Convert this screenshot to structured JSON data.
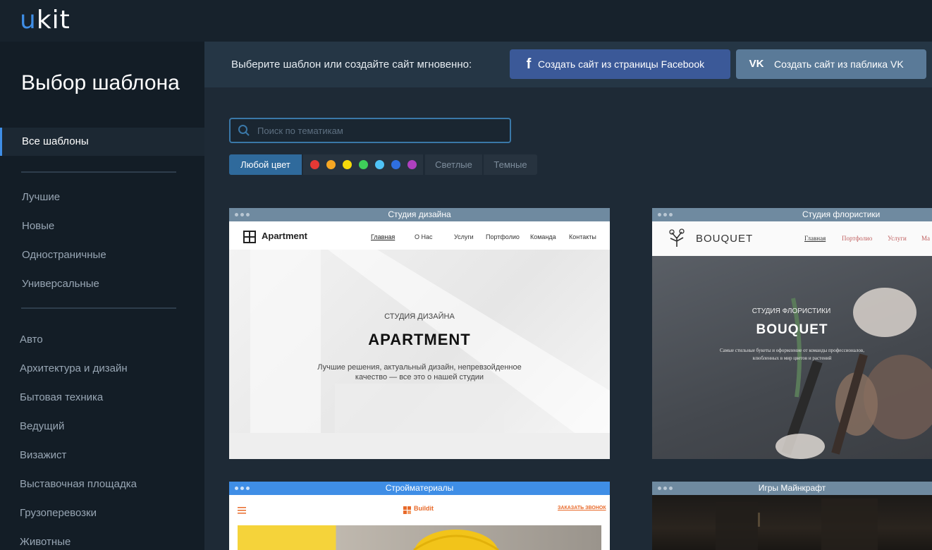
{
  "app": {
    "logo_u": "u",
    "logo_rest": "kit"
  },
  "sidebar": {
    "title": "Выбор шаблона",
    "active": "Все шаблоны",
    "groups": [
      "Лучшие",
      "Новые",
      "Одностраничные",
      "Универсальные"
    ],
    "categories": [
      "Авто",
      "Архитектура и дизайн",
      "Бытовая техника",
      "Ведущий",
      "Визажист",
      "Выставочная площадка",
      "Грузоперевозки",
      "Животные"
    ]
  },
  "promo": {
    "text": "Выберите шаблон или создайте сайт мгновенно:",
    "facebook_btn": "Создать сайт из страницы Facebook",
    "facebook_icon": "f",
    "vk_btn": "Создать сайт из паблика VK",
    "vk_icon": "VK"
  },
  "search": {
    "placeholder": "Поиск по тематикам"
  },
  "filters": {
    "any_color": "Любой цвет",
    "colors": [
      "#e53935",
      "#f5a623",
      "#f5d90a",
      "#3ecf5a",
      "#4fc3f7",
      "#2f6fe0",
      "#b040c0"
    ],
    "light": "Светлые",
    "dark": "Темные"
  },
  "cards": [
    {
      "title": "Студия дизайна",
      "brand": "Apartment",
      "nav": [
        "Главная",
        "О Нас",
        "Услуги",
        "Портфолио",
        "Команда",
        "Контакты"
      ],
      "subtitle": "СТУДИЯ ДИЗАЙНА",
      "heading": "APARTMENT",
      "desc_line1": "Лучшие решения, актуальный дизайн, непревзойденное",
      "desc_line2": "качество — все это о нашей студии"
    },
    {
      "title": "Студия флористики",
      "brand": "BOUQUET",
      "nav": [
        "Главная",
        "Портфолио",
        "Услуги",
        "Ма"
      ],
      "subtitle": "СТУДИЯ ФЛОРИСТИКИ",
      "heading": "BOUQUET",
      "desc_line1": "Самые стильные букеты и оформление от команды профессионалов,",
      "desc_line2": "влюбленных в мир цветов и растений"
    },
    {
      "title": "Стройматериалы",
      "brand": "Buildit",
      "cta": "ЗАКАЗАТЬ ЗВОНОК"
    },
    {
      "title": "Игры Майнкрафт"
    }
  ]
}
